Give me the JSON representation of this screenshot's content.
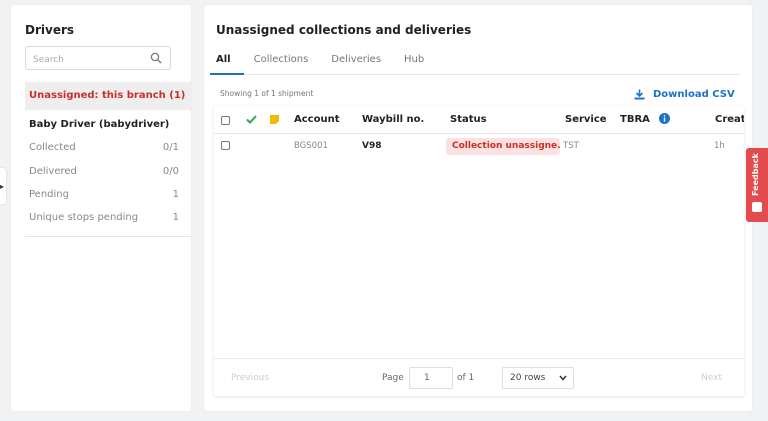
{
  "drivers_panel": {
    "title": "Drivers",
    "search_placeholder": "Search",
    "unassigned_label": "Unassigned: this branch (1)",
    "driver_name": "Baby Driver (babydriver)",
    "stats": [
      {
        "label": "Collected",
        "value": "0/1"
      },
      {
        "label": "Delivered",
        "value": "0/0"
      },
      {
        "label": "Pending",
        "value": "1"
      },
      {
        "label": "Unique stops pending",
        "value": "1"
      }
    ]
  },
  "main_panel": {
    "title": "Unassigned collections and deliveries",
    "tabs": [
      "All",
      "Collections",
      "Deliveries",
      "Hub"
    ],
    "active_tab": "All",
    "showing_text": "Showing 1 of 1 shipment",
    "download_label": "Download CSV",
    "table": {
      "columns": [
        "Account",
        "Waybill no.",
        "Status",
        "Service",
        "TBRA",
        "Creat"
      ],
      "rows": [
        {
          "account": "BGS001",
          "waybill": "V98",
          "status": "Collection unassigne...",
          "service": "TST",
          "created": "1h"
        }
      ]
    },
    "pagination": {
      "previous": "Previous",
      "next": "Next",
      "page_label": "Page",
      "page_value": "1",
      "of_label": "of 1",
      "rows_select": "20 rows"
    }
  },
  "feedback_tab": {
    "label": "Feedback"
  },
  "colors": {
    "accent_blue": "#1b73c8",
    "danger_red": "#c9302c",
    "feedback_red": "#e34b4e",
    "check_green": "#2ea84a",
    "note_yellow": "#f5b800"
  }
}
